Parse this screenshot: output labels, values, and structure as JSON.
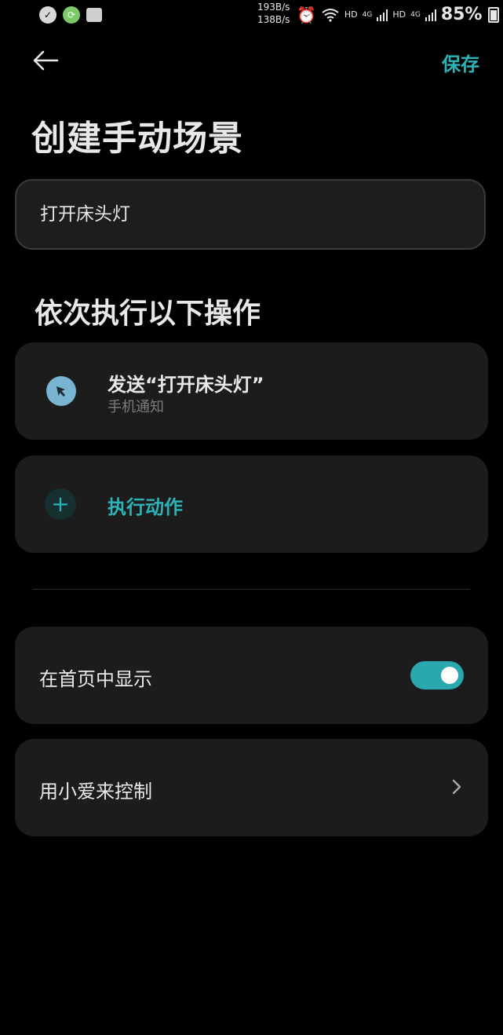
{
  "status_bar": {
    "speed_up": "193B/s",
    "speed_down": "138B/s",
    "hd1": "HD",
    "net1": "4G",
    "hd2": "HD",
    "net2": "4G",
    "battery": "85%",
    "icons": [
      "notification-check-icon",
      "sync-icon",
      "gallery-icon",
      "alarm-icon",
      "wifi-icon",
      "signal-icon",
      "battery-icon"
    ]
  },
  "header": {
    "back_icon": "back-arrow-icon",
    "save_label": "保存",
    "title": "创建手动场景"
  },
  "scene_name": {
    "value": "打开床头灯"
  },
  "actions_section": {
    "title": "依次执行以下操作",
    "items": [
      {
        "title": "发送“打开床头灯”",
        "subtitle": "手机通知",
        "icon": "pointer-icon"
      }
    ],
    "add_label": "执行动作",
    "add_icon": "plus-icon"
  },
  "settings": {
    "show_on_home_label": "在首页中显示",
    "show_on_home_on": true,
    "xiaoai_label": "用小爱来控制"
  },
  "colors": {
    "accent": "#2bb3b8",
    "background": "#000000",
    "card": "#1c1c1c",
    "action_icon_bg": "#7ab4d3"
  }
}
